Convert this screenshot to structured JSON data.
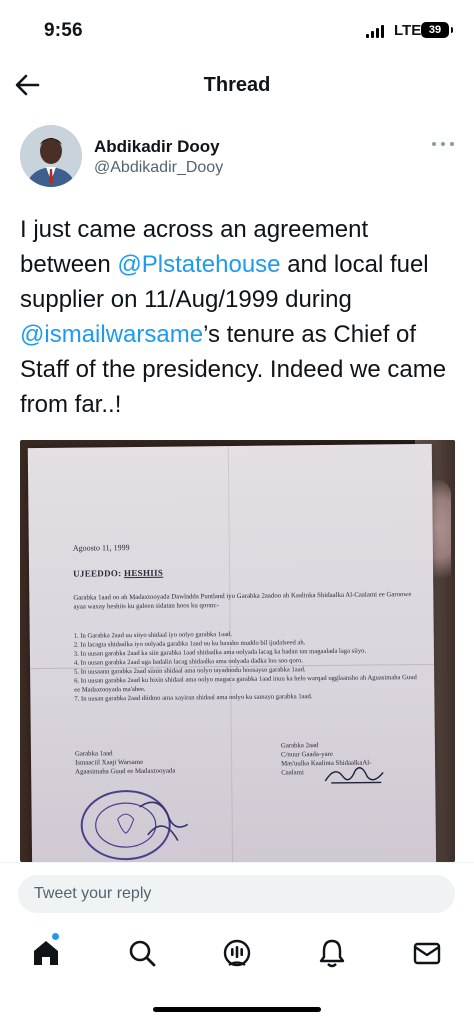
{
  "status_bar": {
    "time": "9:56",
    "network": "LTE",
    "battery": "39"
  },
  "header": {
    "title": "Thread",
    "back_icon": "arrow-left-icon"
  },
  "tweet": {
    "author_name": "Abdikadir Dooy",
    "author_handle": "@Abdikadir_Dooy",
    "text_parts": [
      "I just came across an agreement between ",
      "@Plstatehouse",
      " and local fuel supplier on 11/Aug/1999 during ",
      "@ismailwarsame",
      "’s tenure as Chief of Staff of the presidency. Indeed we came from far..!"
    ],
    "more_icon": "more-horizontal-icon"
  },
  "document_photo": {
    "date": "Agoosto 11, 1999",
    "subject_prefix": "UJEEDDO: ",
    "subject": "HESHIIS",
    "intro": "Garabka 1aad oo ah Madaxtooyada Dawladda Puntland iyo Garabka 2aadoo ah Kaalinka Shidaalka Al-Caalami ee Garoowe ayaa waxay heshiis ku galeen sidatan hoos ku qoran:-",
    "items": [
      "1.  In Garabka 2aad uu siiyo shidaal iyo oolyo garabka 1aad.",
      "2.  In lacagta shidaalka iyo oolyada garabka 1aad uu ku baxsho muddo bil ijudalseed ah.",
      "3.  In uusan garabka 2aad ka siin garabka 1aad shidaalka ama oolyada lacag ka badan tan magaalada laga siiyo.",
      "4.  In uusan garabka 2aad uga badalin lacag shidaalka ama oolyada dadka loo soo qoro.",
      "5.  In uusaann garabka 2aad siinin shidaal ama oolyo tayadoodu hoosayso garabka 1aad.",
      "6.  In uusan garabka 2aad ku bixin shidaal ama oolyo magaca garabka 1aad inuu ka helo warqad ogglaansho ah Aguasimaha Guud ee Madaxtooyada ma'ahee.",
      "7.  In uusan garabka 2aad diidmo ama xayiran shidaal ama oolyo ku samayn garabka 1aad."
    ],
    "sig_left": [
      "Garabka 1aad",
      "Ismaaciil Xaaji Warsame",
      "Agaasimaha Guud ee Madaxtooyada"
    ],
    "sig_right": [
      "Garabka 2aad",
      "C/nuur Gaada-yare",
      "Mas'uulka   Kaalinta   ShidaalkaAl-",
      "Caalami"
    ],
    "stamp_text": "DAWLADA GOBOLEEDKA PUNTLAND"
  },
  "reply_bar": {
    "placeholder": "Tweet your reply"
  },
  "tab_bar": {
    "items": [
      "home-icon",
      "search-icon",
      "spaces-icon",
      "notifications-icon",
      "messages-icon"
    ]
  },
  "colors": {
    "accent": "#1d9bf0",
    "text": "#0f1419",
    "secondary": "#536471"
  }
}
